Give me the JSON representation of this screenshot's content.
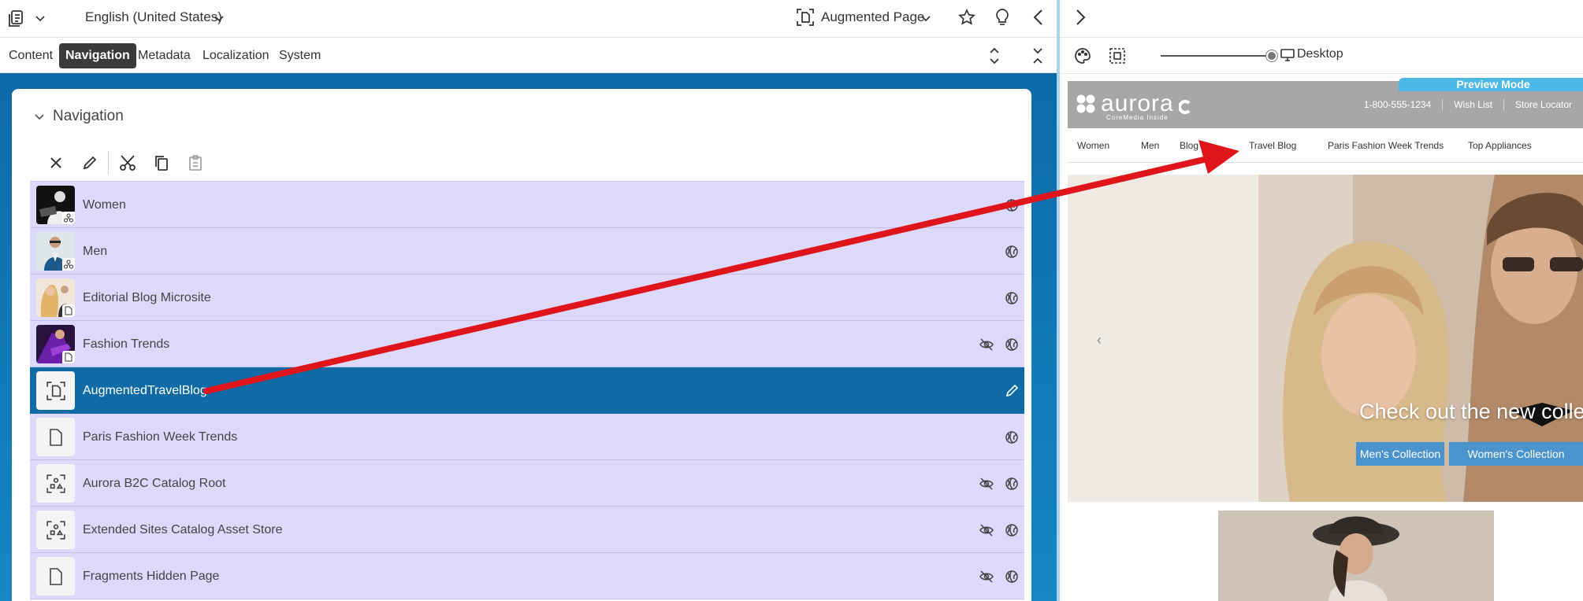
{
  "topbar": {
    "language": "English (United States)",
    "page_type": "Augmented Page"
  },
  "tabs": [
    {
      "label": "Content",
      "active": false
    },
    {
      "label": "Navigation",
      "active": true
    },
    {
      "label": "Metadata",
      "active": false
    },
    {
      "label": "Localization",
      "active": false
    },
    {
      "label": "System",
      "active": false
    }
  ],
  "navigation": {
    "title": "Navigation",
    "actions": [
      "close-icon",
      "pencil-icon",
      "scissors-icon",
      "copy-icon",
      "clipboard-icon"
    ],
    "items": [
      {
        "label": "Women",
        "thumb": "photo",
        "badge": "sitemap-icon",
        "icons": [
          "globe-icon"
        ],
        "selected": false
      },
      {
        "label": "Men",
        "thumb": "photo",
        "badge": "sitemap-icon",
        "icons": [
          "globe-icon"
        ],
        "selected": false
      },
      {
        "label": "Editorial Blog Microsite",
        "thumb": "photo",
        "badge": "document-icon",
        "icons": [
          "globe-icon"
        ],
        "selected": false
      },
      {
        "label": "Fashion Trends",
        "thumb": "photo",
        "badge": "document-icon",
        "icons": [
          "eye-off-icon",
          "globe-icon"
        ],
        "selected": false
      },
      {
        "label": "AugmentedTravelBlog",
        "thumb": "augmented-page-icon",
        "badge": "",
        "icons": [
          "pencil-icon"
        ],
        "selected": true
      },
      {
        "label": "Paris Fashion Week Trends",
        "thumb": "document-icon",
        "badge": "",
        "icons": [
          "globe-icon"
        ],
        "selected": false
      },
      {
        "label": "Aurora B2C Catalog Root",
        "thumb": "catalog-icon",
        "badge": "",
        "icons": [
          "eye-off-icon",
          "globe-icon"
        ],
        "selected": false
      },
      {
        "label": "Extended Sites Catalog Asset Store",
        "thumb": "catalog-icon",
        "badge": "",
        "icons": [
          "eye-off-icon",
          "globe-icon"
        ],
        "selected": false
      },
      {
        "label": "Fragments Hidden Page",
        "thumb": "document-icon",
        "badge": "",
        "icons": [
          "eye-off-icon",
          "globe-icon"
        ],
        "selected": false
      }
    ]
  },
  "preview": {
    "device": "Desktop",
    "banner": "Preview Mode",
    "logo": "aurora",
    "logo_sub": "CoreMedia Inside",
    "header_links": [
      "1-800-555-1234",
      "Wish List",
      "Store Locator"
    ],
    "nav": [
      "Women",
      "Men",
      "Blog",
      "Travel Blog",
      "Paris Fashion Week Trends",
      "Top Appliances"
    ],
    "hero_text": "Check out the new collection",
    "hero_buttons": [
      "Men's Collection",
      "Women's Collection"
    ]
  },
  "colors": {
    "accent": "#0f6aa6",
    "row_bg": "#dcd9fb",
    "annotation_arrow": "#e0141b",
    "site_header": "#a7a7a7",
    "preview_banner": "#4bb8e8"
  }
}
